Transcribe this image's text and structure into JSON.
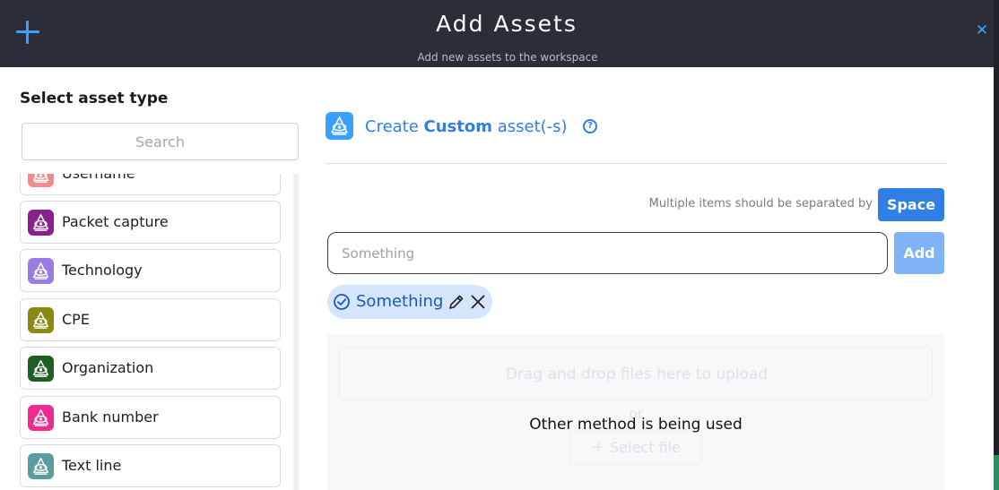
{
  "header": {
    "title": "Add Assets",
    "subtitle": "Add new assets to the workspace",
    "add_icon": "plus-icon",
    "close_icon": "close-icon"
  },
  "sidebar": {
    "title": "Select asset type",
    "search_placeholder": "Search",
    "items": [
      {
        "label": "Username",
        "color": "#f28b8b"
      },
      {
        "label": "Packet capture",
        "color": "#8a1f8f"
      },
      {
        "label": "Technology",
        "color": "#9a7be0"
      },
      {
        "label": "CPE",
        "color": "#8a8a10"
      },
      {
        "label": "Organization",
        "color": "#1e5e25"
      },
      {
        "label": "Bank number",
        "color": "#ef2b93"
      },
      {
        "label": "Text line",
        "color": "#5c9b9f"
      }
    ]
  },
  "main": {
    "create_prefix": "Create ",
    "create_type": "Custom",
    "create_suffix": " asset(-s)",
    "help_icon": "question-icon",
    "separator_hint": "Multiple items should be separated by",
    "separator_button": "Space",
    "input_placeholder": "Something",
    "add_button": "Add",
    "chips": [
      {
        "label": "Something"
      }
    ],
    "upload": {
      "drop_text": "Drag and drop files here to upload",
      "or_text": "or",
      "select_button": "Select file",
      "overlay_text": "Other method is being used"
    }
  },
  "colors": {
    "accent": "#2f7fe5",
    "header_bg": "#2b2e38",
    "plus_color": "#3aa0ff"
  }
}
